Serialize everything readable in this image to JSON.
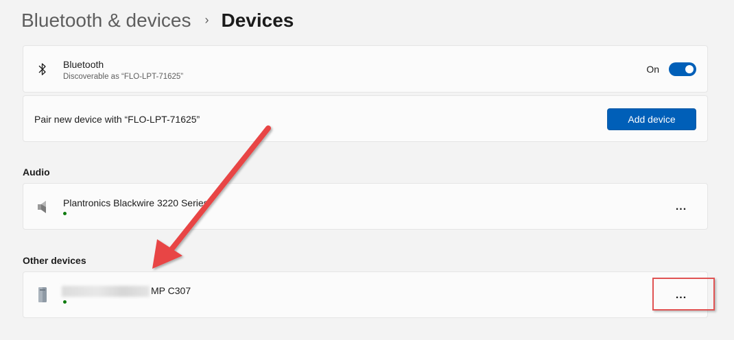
{
  "breadcrumb": {
    "parent": "Bluetooth & devices",
    "separator": "›",
    "current": "Devices"
  },
  "bluetooth": {
    "title": "Bluetooth",
    "subtitle": "Discoverable as “FLO-LPT-71625”",
    "toggle_label": "On",
    "toggle_on": true,
    "icon": "bluetooth-icon"
  },
  "pair": {
    "label": "Pair new device with “FLO-LPT-71625”",
    "button_label": "Add device"
  },
  "sections": {
    "audio": "Audio",
    "other": "Other devices"
  },
  "audio_device": {
    "name": "Plantronics Blackwire 3220 Series",
    "icon": "speaker-icon",
    "status_color": "#0f7b0f",
    "more_label": "..."
  },
  "other_device": {
    "name_visible": "MP C307",
    "icon": "printer-tower-icon",
    "status_color": "#0f7b0f",
    "more_label": "..."
  },
  "colors": {
    "accent": "#005fb8",
    "annotation": "#e84545"
  }
}
